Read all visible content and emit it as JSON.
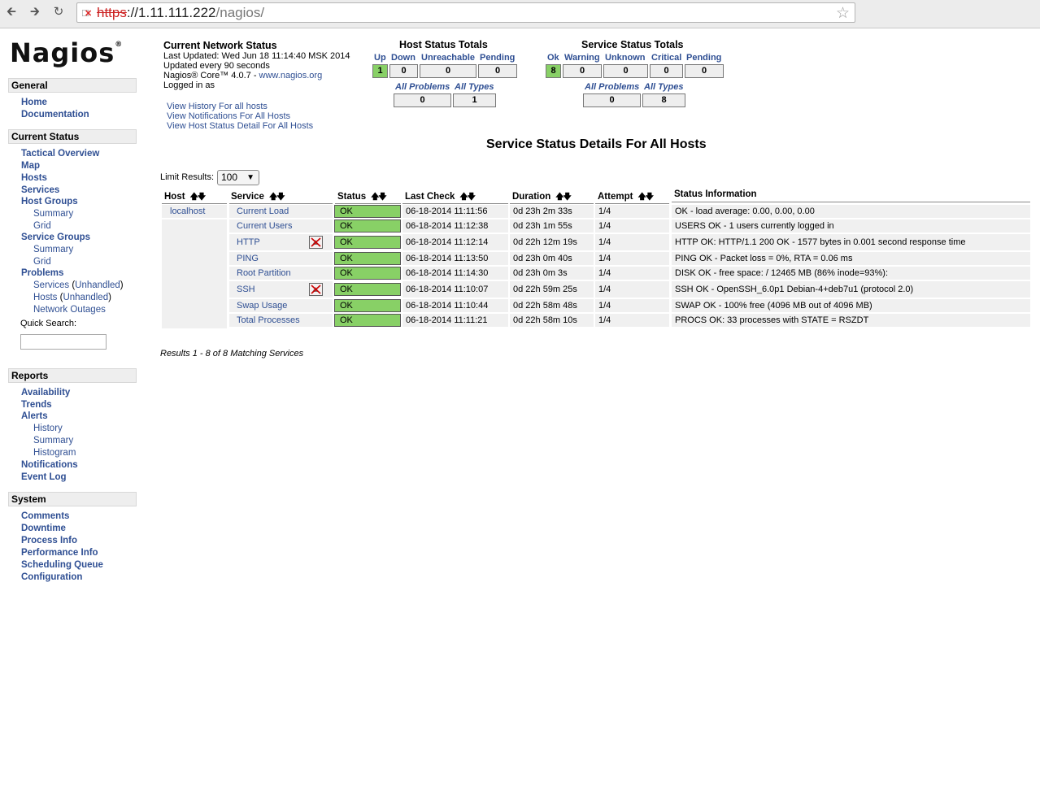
{
  "browser": {
    "url_scheme": "https",
    "url_host": "://1.11.111.222",
    "url_path": "/nagios/"
  },
  "logo": {
    "name": "Nagios",
    "reg": "®"
  },
  "sidebar": {
    "sections": {
      "general": "General",
      "current_status": "Current Status",
      "reports": "Reports",
      "system": "System"
    },
    "links": {
      "home": "Home",
      "documentation": "Documentation",
      "tactical_overview": "Tactical Overview",
      "map": "Map",
      "hosts": "Hosts",
      "services": "Services",
      "host_groups": "Host Groups",
      "hg_summary": "Summary",
      "hg_grid": "Grid",
      "service_groups": "Service Groups",
      "sg_summary": "Summary",
      "sg_grid": "Grid",
      "problems": "Problems",
      "prob_services": "Services",
      "prob_services_unhandled": "Unhandled",
      "prob_hosts": "Hosts",
      "prob_hosts_unhandled": "Unhandled",
      "network_outages": "Network Outages",
      "availability": "Availability",
      "trends": "Trends",
      "alerts": "Alerts",
      "alerts_history": "History",
      "alerts_summary": "Summary",
      "alerts_histogram": "Histogram",
      "notifications": "Notifications",
      "event_log": "Event Log",
      "comments": "Comments",
      "downtime": "Downtime",
      "process_info": "Process Info",
      "performance_info": "Performance Info",
      "scheduling_queue": "Scheduling Queue",
      "configuration": "Configuration"
    },
    "quick_search_label": "Quick Search:",
    "quick_search_value": ""
  },
  "info": {
    "title": "Current Network Status",
    "last_updated": "Last Updated: Wed Jun 18 11:14:40 MSK 2014",
    "update_interval": "Updated every 90 seconds",
    "core_text": "Nagios® Core™ 4.0.7 - ",
    "core_link": "www.nagios.org",
    "logged_in": "Logged in as",
    "link_history": "View History For all hosts",
    "link_notifications": "View Notifications For All Hosts",
    "link_host_detail": "View Host Status Detail For All Hosts"
  },
  "host_totals": {
    "title": "Host Status Totals",
    "labels": {
      "up": "Up",
      "down": "Down",
      "unreachable": "Unreachable",
      "pending": "Pending"
    },
    "values": {
      "up": "1",
      "down": "0",
      "unreachable": "0",
      "pending": "0"
    },
    "all_problems_label": "All Problems",
    "all_types_label": "All Types",
    "all_problems": "0",
    "all_types": "1"
  },
  "service_totals": {
    "title": "Service Status Totals",
    "labels": {
      "ok": "Ok",
      "warning": "Warning",
      "unknown": "Unknown",
      "critical": "Critical",
      "pending": "Pending"
    },
    "values": {
      "ok": "8",
      "warning": "0",
      "unknown": "0",
      "critical": "0",
      "pending": "0"
    },
    "all_problems_label": "All Problems",
    "all_types_label": "All Types",
    "all_problems": "0",
    "all_types": "8"
  },
  "main_title": "Service Status Details For All Hosts",
  "limit": {
    "label": "Limit Results:",
    "value": "100"
  },
  "table": {
    "headers": {
      "host": "Host",
      "service": "Service",
      "status": "Status",
      "last_check": "Last Check",
      "duration": "Duration",
      "attempt": "Attempt",
      "status_info": "Status Information"
    },
    "rows": [
      {
        "host": "localhost",
        "service": "Current Load",
        "status": "OK",
        "last_check": "06-18-2014 11:11:56",
        "duration": "0d 23h 2m 33s",
        "attempt": "1/4",
        "info": "OK - load average: 0.00, 0.00, 0.00"
      },
      {
        "host": "",
        "service": "Current Users",
        "status": "OK",
        "last_check": "06-18-2014 11:12:38",
        "duration": "0d 23h 1m 55s",
        "attempt": "1/4",
        "info": "USERS OK - 1 users currently logged in"
      },
      {
        "host": "",
        "service": "HTTP",
        "status": "OK",
        "last_check": "06-18-2014 11:12:14",
        "duration": "0d 22h 12m 19s",
        "attempt": "1/4",
        "info": "HTTP OK: HTTP/1.1 200 OK - 1577 bytes in 0.001 second response time"
      },
      {
        "host": "",
        "service": "PING",
        "status": "OK",
        "last_check": "06-18-2014 11:13:50",
        "duration": "0d 23h 0m 40s",
        "attempt": "1/4",
        "info": "PING OK - Packet loss = 0%, RTA = 0.06 ms"
      },
      {
        "host": "",
        "service": "Root Partition",
        "status": "OK",
        "last_check": "06-18-2014 11:14:30",
        "duration": "0d 23h 0m 3s",
        "attempt": "1/4",
        "info": "DISK OK - free space: / 12465 MB (86% inode=93%):"
      },
      {
        "host": "",
        "service": "SSH",
        "status": "OK",
        "last_check": "06-18-2014 11:10:07",
        "duration": "0d 22h 59m 25s",
        "attempt": "1/4",
        "info": "SSH OK - OpenSSH_6.0p1 Debian-4+deb7u1 (protocol 2.0)"
      },
      {
        "host": "",
        "service": "Swap Usage",
        "status": "OK",
        "last_check": "06-18-2014 11:10:44",
        "duration": "0d 22h 58m 48s",
        "attempt": "1/4",
        "info": "SWAP OK - 100% free (4096 MB out of 4096 MB)"
      },
      {
        "host": "",
        "service": "Total Processes",
        "status": "OK",
        "last_check": "06-18-2014 11:11:21",
        "duration": "0d 22h 58m 10s",
        "attempt": "1/4",
        "info": "PROCS OK: 33 processes with STATE = RSZDT"
      }
    ]
  },
  "results_text": "Results 1 - 8 of 8 Matching Services",
  "colors": {
    "ok": "#88d066",
    "link": "#2f4f93",
    "header_bg": "#eeeeee"
  },
  "icons": {
    "notifications_disabled": "notifications-disabled-icon"
  }
}
